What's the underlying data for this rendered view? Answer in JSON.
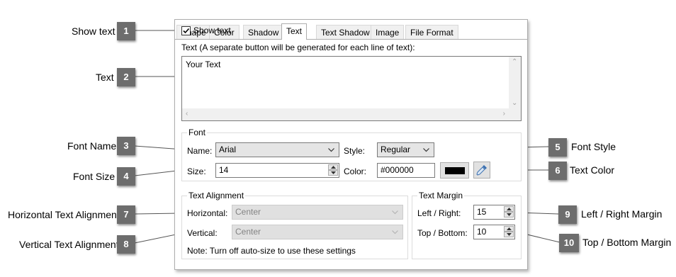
{
  "tabs": [
    "Shape",
    "Color",
    "Shadow",
    "Text",
    "Text Shadow",
    "Image",
    "File Format"
  ],
  "active_tab": "Text",
  "show_text": {
    "label": "Show text",
    "checked": true
  },
  "text_section": {
    "label": "Text (A separate button will be generated for each line of text):",
    "value": "Your Text"
  },
  "font": {
    "title": "Font",
    "name_label": "Name:",
    "name_value": "Arial",
    "style_label": "Style:",
    "style_value": "Regular",
    "size_label": "Size:",
    "size_value": "14",
    "color_label": "Color:",
    "color_value": "#000000",
    "swatch_color": "#000000"
  },
  "alignment": {
    "title": "Text Alignment",
    "horizontal_label": "Horizontal:",
    "horizontal_value": "Center",
    "vertical_label": "Vertical:",
    "vertical_value": "Center",
    "note": "Note: Turn off auto-size to use these settings"
  },
  "margin": {
    "title": "Text Margin",
    "lr_label": "Left / Right:",
    "lr_value": "15",
    "tb_label": "Top / Bottom:",
    "tb_value": "10"
  },
  "callouts": [
    {
      "num": "1",
      "label": "Show text"
    },
    {
      "num": "2",
      "label": "Text"
    },
    {
      "num": "3",
      "label": "Font Name"
    },
    {
      "num": "4",
      "label": "Font Size"
    },
    {
      "num": "5",
      "label": "Font Style"
    },
    {
      "num": "6",
      "label": "Text Color"
    },
    {
      "num": "7",
      "label": "Horizontal Text Alignment"
    },
    {
      "num": "8",
      "label": "Vertical Text Alignment"
    },
    {
      "num": "9",
      "label": "Left / Right Margin"
    },
    {
      "num": "10",
      "label": "Top / Bottom Margin"
    }
  ],
  "colors": {
    "marker": "#6d6d6d",
    "border": "#adadad"
  }
}
